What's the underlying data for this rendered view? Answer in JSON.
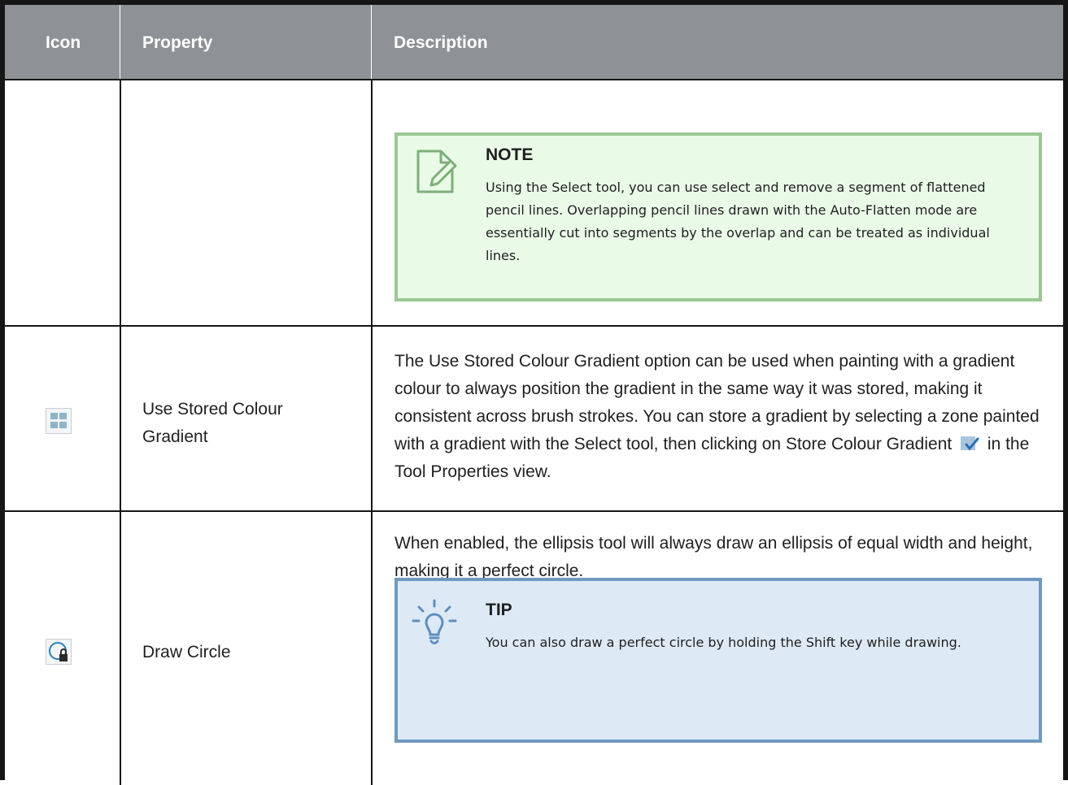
{
  "table": {
    "headers": {
      "icon": "Icon",
      "property": "Property",
      "description": "Description"
    },
    "rows": [
      {
        "icon": null,
        "property": "",
        "note": {
          "icon": "note-pencil-icon",
          "title": "NOTE",
          "body": "Using the Select tool, you can use select and remove a segment of flattened pencil lines. Overlapping pencil lines drawn with the Auto-Flatten mode are essentially cut into segments by the overlap and can be treated as individual lines."
        }
      },
      {
        "icon": "stored-gradient-grid-icon",
        "property": "Use Stored Colour Gradient",
        "description_before": "The Use Stored Colour Gradient option can be used when painting with a gradient colour to always position the gradient in the same way it was stored, making it consistent across brush strokes. You can store a gradient by selecting a zone painted with a gradient with the Select tool, then clicking on Store Colour Gradient",
        "inline_icon": "store-colour-gradient-icon",
        "description_after": "in the Tool Properties view."
      },
      {
        "icon": "draw-circle-lock-icon",
        "property": "Draw Circle",
        "description": "When enabled, the ellipsis tool will always draw an ellipsis of equal width and height, making it a perfect circle.",
        "tip": {
          "icon": "lightbulb-icon",
          "title": "TIP",
          "body": "You can also draw a perfect circle by holding the Shift key while drawing."
        }
      }
    ]
  },
  "colors": {
    "header_bg": "#8e9196",
    "note_bg": "#e9fae7",
    "note_border": "#9bc794",
    "tip_bg": "#ddeaf6",
    "tip_border": "#6f99c0"
  }
}
